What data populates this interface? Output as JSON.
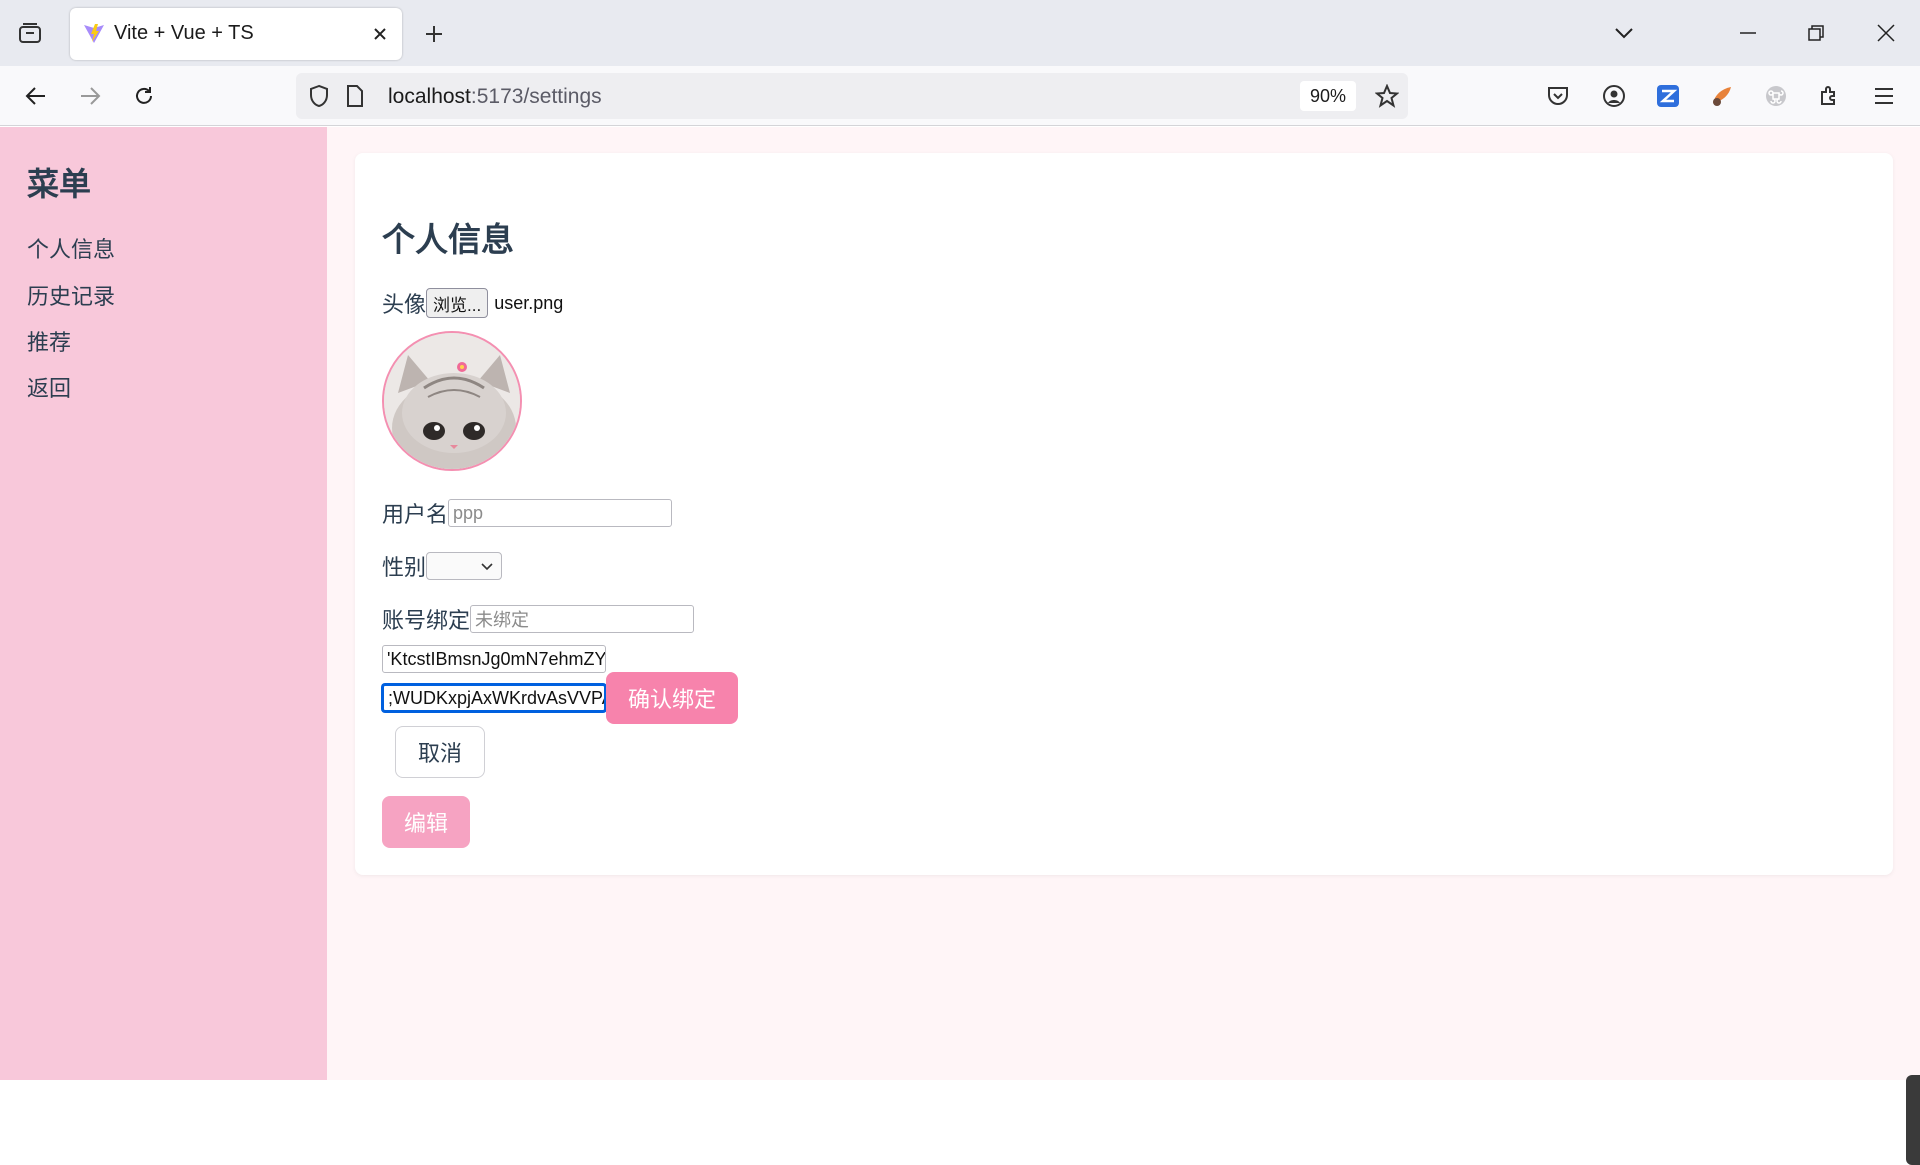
{
  "browser": {
    "tab_title": "Vite + Vue + TS",
    "url_host": "localhost",
    "url_path": ":5173/settings",
    "zoom": "90%"
  },
  "sidebar": {
    "title": "菜单",
    "items": [
      {
        "label": "个人信息"
      },
      {
        "label": "历史记录"
      },
      {
        "label": "推荐"
      },
      {
        "label": "返回"
      }
    ]
  },
  "profile": {
    "title": "个人信息",
    "avatar_label": "头像",
    "browse_button": "浏览...",
    "file_name": "user.png",
    "username_label": "用户名",
    "username_placeholder": "ppp",
    "gender_label": "性别",
    "gender_value": "",
    "binding_label": "账号绑定",
    "binding_placeholder": "未绑定",
    "binding_field1": "'KtcstIBmsnJg0mN7ehmZY",
    "binding_field2": ";WUDKxpjAxWKrdvAsVVPA",
    "confirm_button": "确认绑定",
    "cancel_button": "取消",
    "edit_button": "编辑"
  },
  "colors": {
    "sidebar_bg": "#f8c8da",
    "accent": "#f783ac",
    "text": "#2c3e50"
  }
}
